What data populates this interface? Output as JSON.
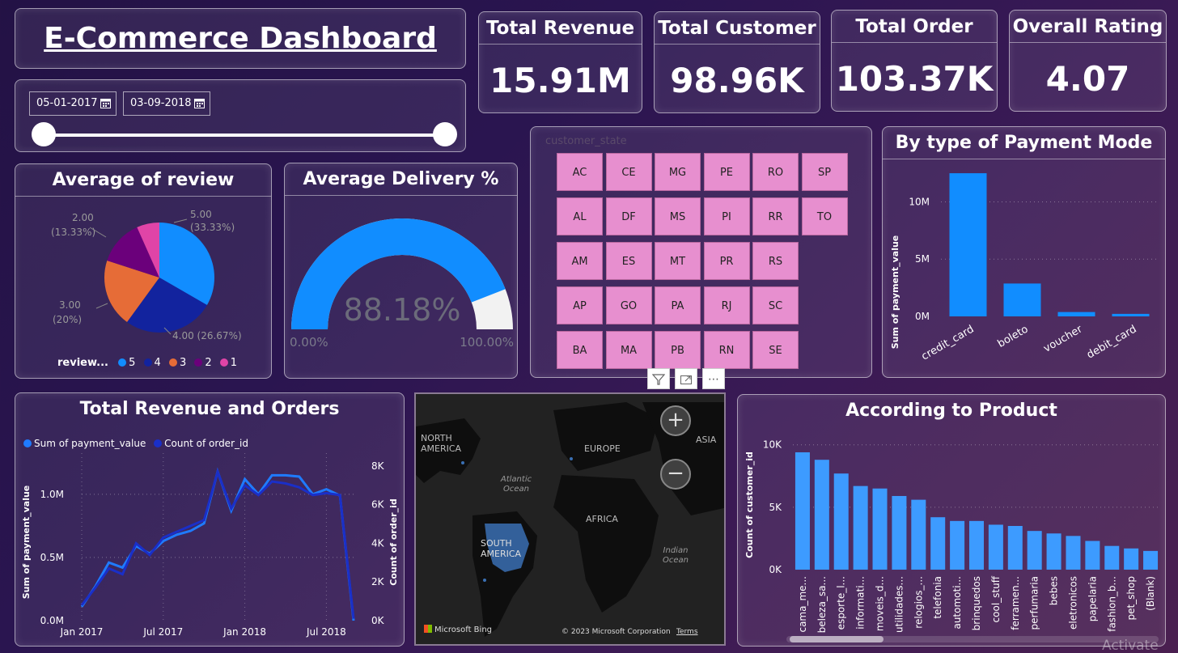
{
  "header": {
    "title": "E-Commerce Dashboard"
  },
  "date_filter": {
    "start": "05-01-2017",
    "end": "03-09-2018"
  },
  "kpis": [
    {
      "label": "Total Revenue",
      "value": "15.91M"
    },
    {
      "label": "Total Customer",
      "value": "98.96K"
    },
    {
      "label": "Total Order",
      "value": "103.37K"
    },
    {
      "label": "Overall Rating",
      "value": "4.07"
    }
  ],
  "state_panel": {
    "header": "customer_state",
    "states": [
      [
        "AC",
        "CE",
        "MG",
        "PE",
        "RO",
        "SP"
      ],
      [
        "AL",
        "DF",
        "MS",
        "PI",
        "RR",
        "TO"
      ],
      [
        "AM",
        "ES",
        "MT",
        "PR",
        "RS"
      ],
      [
        "AP",
        "GO",
        "PA",
        "RJ",
        "SC"
      ],
      [
        "BA",
        "MA",
        "PB",
        "RN",
        "SE"
      ]
    ],
    "tile_color": "#e78fcf"
  },
  "map": {
    "labels": [
      "NORTH AMERICA",
      "EUROPE",
      "ASIA",
      "Atlantic Ocean",
      "AFRICA",
      "SOUTH AMERICA",
      "Indian Ocean"
    ],
    "attribution": "Microsoft Bing",
    "copyright": "© 2023 Microsoft Corporation",
    "terms": "Terms",
    "zoom_in": "+",
    "zoom_out": "−"
  },
  "toolbar": {
    "filter_icon": "filter-icon",
    "focus_icon": "focus-mode-icon",
    "more_label": "⋯"
  },
  "watermark": "Activate",
  "chart_data": [
    {
      "id": "review_pie",
      "type": "pie",
      "title": "Average of review",
      "legend_title": "review...",
      "slices": [
        {
          "label": "5",
          "value": 33.33,
          "display": "5.00",
          "pct": "(33.33%)",
          "color": "#118dff"
        },
        {
          "label": "4",
          "value": 26.67,
          "display": "4.00 (26.67%)",
          "color": "#12239e"
        },
        {
          "label": "3",
          "value": 20.0,
          "display": "3.00",
          "pct": "(20%)",
          "color": "#e66c37"
        },
        {
          "label": "2",
          "value": 13.33,
          "display": "2.00",
          "pct": "(13.33%)",
          "color": "#6b007b"
        },
        {
          "label": "1",
          "value": 6.67,
          "color": "#e044a7"
        }
      ],
      "legend_position": "bottom"
    },
    {
      "id": "delivery_gauge",
      "type": "gauge",
      "title": "Average Delivery %",
      "value": 88.18,
      "value_label": "88.18%",
      "min_label": "0.00%",
      "max_label": "100.00%",
      "fill_color": "#118dff",
      "track_color": "#f2f2f2"
    },
    {
      "id": "payment_bar",
      "type": "bar",
      "title": "By type of Payment Mode",
      "categories": [
        "credit_card",
        "boleto",
        "voucher",
        "debit_card"
      ],
      "values": [
        12500000,
        2870000,
        380000,
        220000
      ],
      "ylabel": "Sum of payment_value",
      "yticks": [
        0,
        5000000,
        10000000
      ],
      "ytick_labels": [
        "0M",
        "5M",
        "10M"
      ],
      "ylim": [
        0,
        13000000
      ],
      "color": "#118dff"
    },
    {
      "id": "revenue_orders_line",
      "type": "line",
      "title": "Total Revenue and Orders",
      "x_tick_labels": [
        "Jan 2017",
        "Jul 2017",
        "Jan 2018",
        "Jul 2018"
      ],
      "series": [
        {
          "name": "Sum of payment_value",
          "axis": "left",
          "color": "#1f7bff",
          "values": [
            0.11,
            0.27,
            0.46,
            0.42,
            0.59,
            0.53,
            0.63,
            0.68,
            0.71,
            0.77,
            1.18,
            0.87,
            1.12,
            1.0,
            1.15,
            1.15,
            1.14,
            1.0,
            1.04,
            0.99,
            0.0
          ]
        },
        {
          "name": "Count of order_id",
          "axis": "right",
          "color": "#1a2fc8",
          "values": [
            800,
            1700,
            2700,
            2400,
            4000,
            3400,
            4300,
            4600,
            4900,
            5200,
            7700,
            5800,
            7000,
            6500,
            7200,
            7100,
            6900,
            6500,
            6600,
            6500,
            100
          ]
        }
      ],
      "ylabel": "Sum of payment_value",
      "ylabel_right": "Count of order_id",
      "yticks_left": [
        "0.0M",
        "0.5M",
        "1.0M"
      ],
      "ylim_left": [
        0,
        1.3
      ],
      "yticks_right": [
        "0K",
        "2K",
        "4K",
        "6K",
        "8K"
      ],
      "ylim_right": [
        0,
        8500
      ]
    },
    {
      "id": "product_bar",
      "type": "bar",
      "title": "According to Product",
      "categories": [
        "cama_me...",
        "beleza_sa...",
        "esporte_l...",
        "informati...",
        "moveis_d...",
        "utilidades...",
        "relogios_...",
        "telefonia",
        "automoti...",
        "brinquedos",
        "cool_stuff",
        "ferramen...",
        "perfumaria",
        "bebes",
        "eletronicos",
        "papelaria",
        "fashion_b...",
        "pet_shop",
        "(Blank)"
      ],
      "values": [
        9400,
        8800,
        7700,
        6700,
        6500,
        5900,
        5600,
        4200,
        3900,
        3900,
        3600,
        3500,
        3100,
        2900,
        2700,
        2300,
        1900,
        1700,
        1500
      ],
      "ylabel": "Count of customer_id",
      "yticks": [
        "0K",
        "5K",
        "10K"
      ],
      "ylim": [
        0,
        10500
      ],
      "color": "#3d9bff"
    }
  ]
}
